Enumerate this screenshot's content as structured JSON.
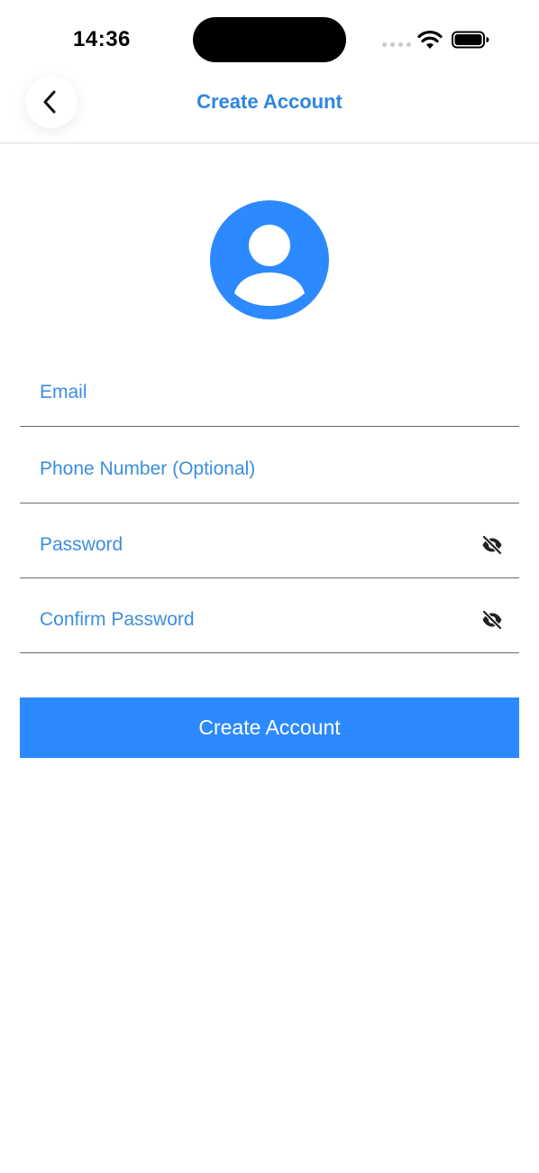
{
  "status_bar": {
    "time": "14:36",
    "icons": [
      "signal-dots-icon",
      "wifi-icon",
      "battery-icon"
    ]
  },
  "header": {
    "title": "Create Account",
    "back_icon": "chevron-left-icon"
  },
  "avatar": {
    "icon": "user-avatar-icon",
    "color": "#2d89ff"
  },
  "form": {
    "email_placeholder": "Email",
    "phone_placeholder": "Phone Number (Optional)",
    "password_placeholder": "Password",
    "confirm_password_placeholder": "Confirm Password",
    "visibility_icon": "eye-off-icon"
  },
  "submit": {
    "label": "Create Account"
  },
  "colors": {
    "accent": "#2d89ff",
    "title_blue": "#2f86e0",
    "field_underline": "#6b6b6b"
  }
}
